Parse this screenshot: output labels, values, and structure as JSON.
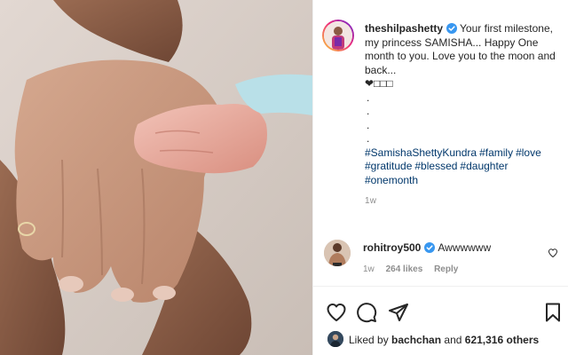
{
  "post": {
    "image_alt": "Adult hands cradling a newborn baby's hand"
  },
  "caption": {
    "username": "theshilpashetty",
    "text": "Your first milestone, my princess SAMISHA... Happy One month to you. Love you to the moon and back...",
    "emoji_line": "❤︎□□□",
    "dots": [
      ".",
      ".",
      ".",
      "."
    ],
    "hashtags": [
      "#SamishaShettyKundra",
      "#family",
      "#love",
      "#gratitude",
      "#blessed",
      "#daughter",
      "#onemonth"
    ],
    "time": "1w"
  },
  "comment": {
    "username": "rohitroy500",
    "text": "Awwwwww",
    "time": "1w",
    "likes": "264 likes",
    "reply": "Reply"
  },
  "likes": {
    "prefix": "Liked by",
    "user": "bachchan",
    "joiner": "and",
    "others": "621,316 others"
  },
  "colors": {
    "verified": "#3897f0",
    "hashtag": "#00376b",
    "meta": "#8e8e8e",
    "text": "#262626"
  },
  "icons": {
    "like": "heart-icon",
    "comment": "comment-icon",
    "share": "share-icon",
    "save": "bookmark-icon",
    "verified": "verified-badge-icon"
  }
}
